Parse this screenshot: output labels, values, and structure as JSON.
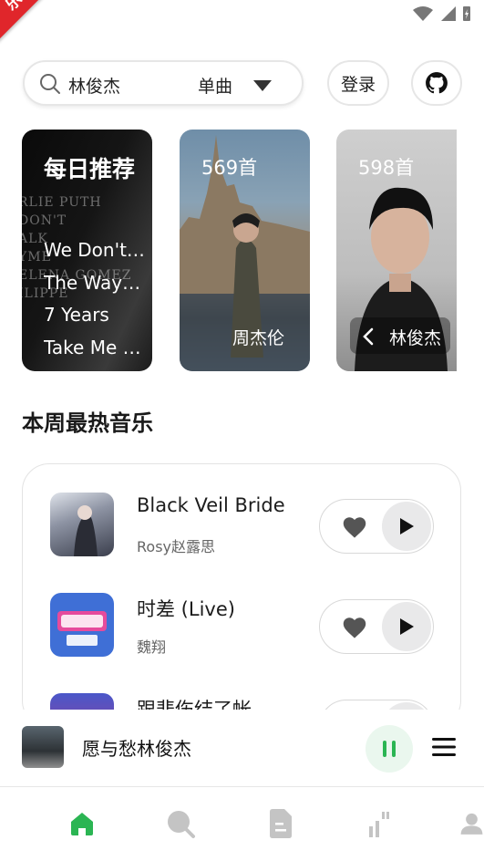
{
  "badge": {
    "text": "乐乐亲测"
  },
  "search": {
    "query": "林俊杰",
    "mode": "单曲"
  },
  "header": {
    "login_label": "登录",
    "github_icon": "github-icon"
  },
  "cards": {
    "daily": {
      "title": "每日推荐",
      "bg_text": [
        "RLIE PUTH",
        "DON'T",
        "ALK",
        "YME",
        "ELENA GOMEZ",
        "ILIPPE"
      ],
      "songs": [
        "We Don't Talk",
        "The Way I Am",
        "7 Years",
        "Take Me Away"
      ]
    },
    "playlists": [
      {
        "count": "569首",
        "artist": "周杰伦"
      },
      {
        "count": "598首",
        "artist": "林俊杰"
      }
    ]
  },
  "section": {
    "title": "本周最热音乐"
  },
  "songs": [
    {
      "title": "Black Veil Bride",
      "artist": "Rosy赵露思"
    },
    {
      "title": "时差 (Live)",
      "artist": "魏翔"
    },
    {
      "title": "跟悲伤结了帐",
      "artist": ""
    }
  ],
  "now_playing": {
    "title": "愿与愁林俊杰"
  },
  "nav": {
    "items": [
      "home-icon",
      "search-icon",
      "document-icon",
      "chart-icon",
      "profile-icon"
    ],
    "active": 0
  },
  "colors": {
    "accent": "#2bb553",
    "badge": "#e0262b"
  }
}
